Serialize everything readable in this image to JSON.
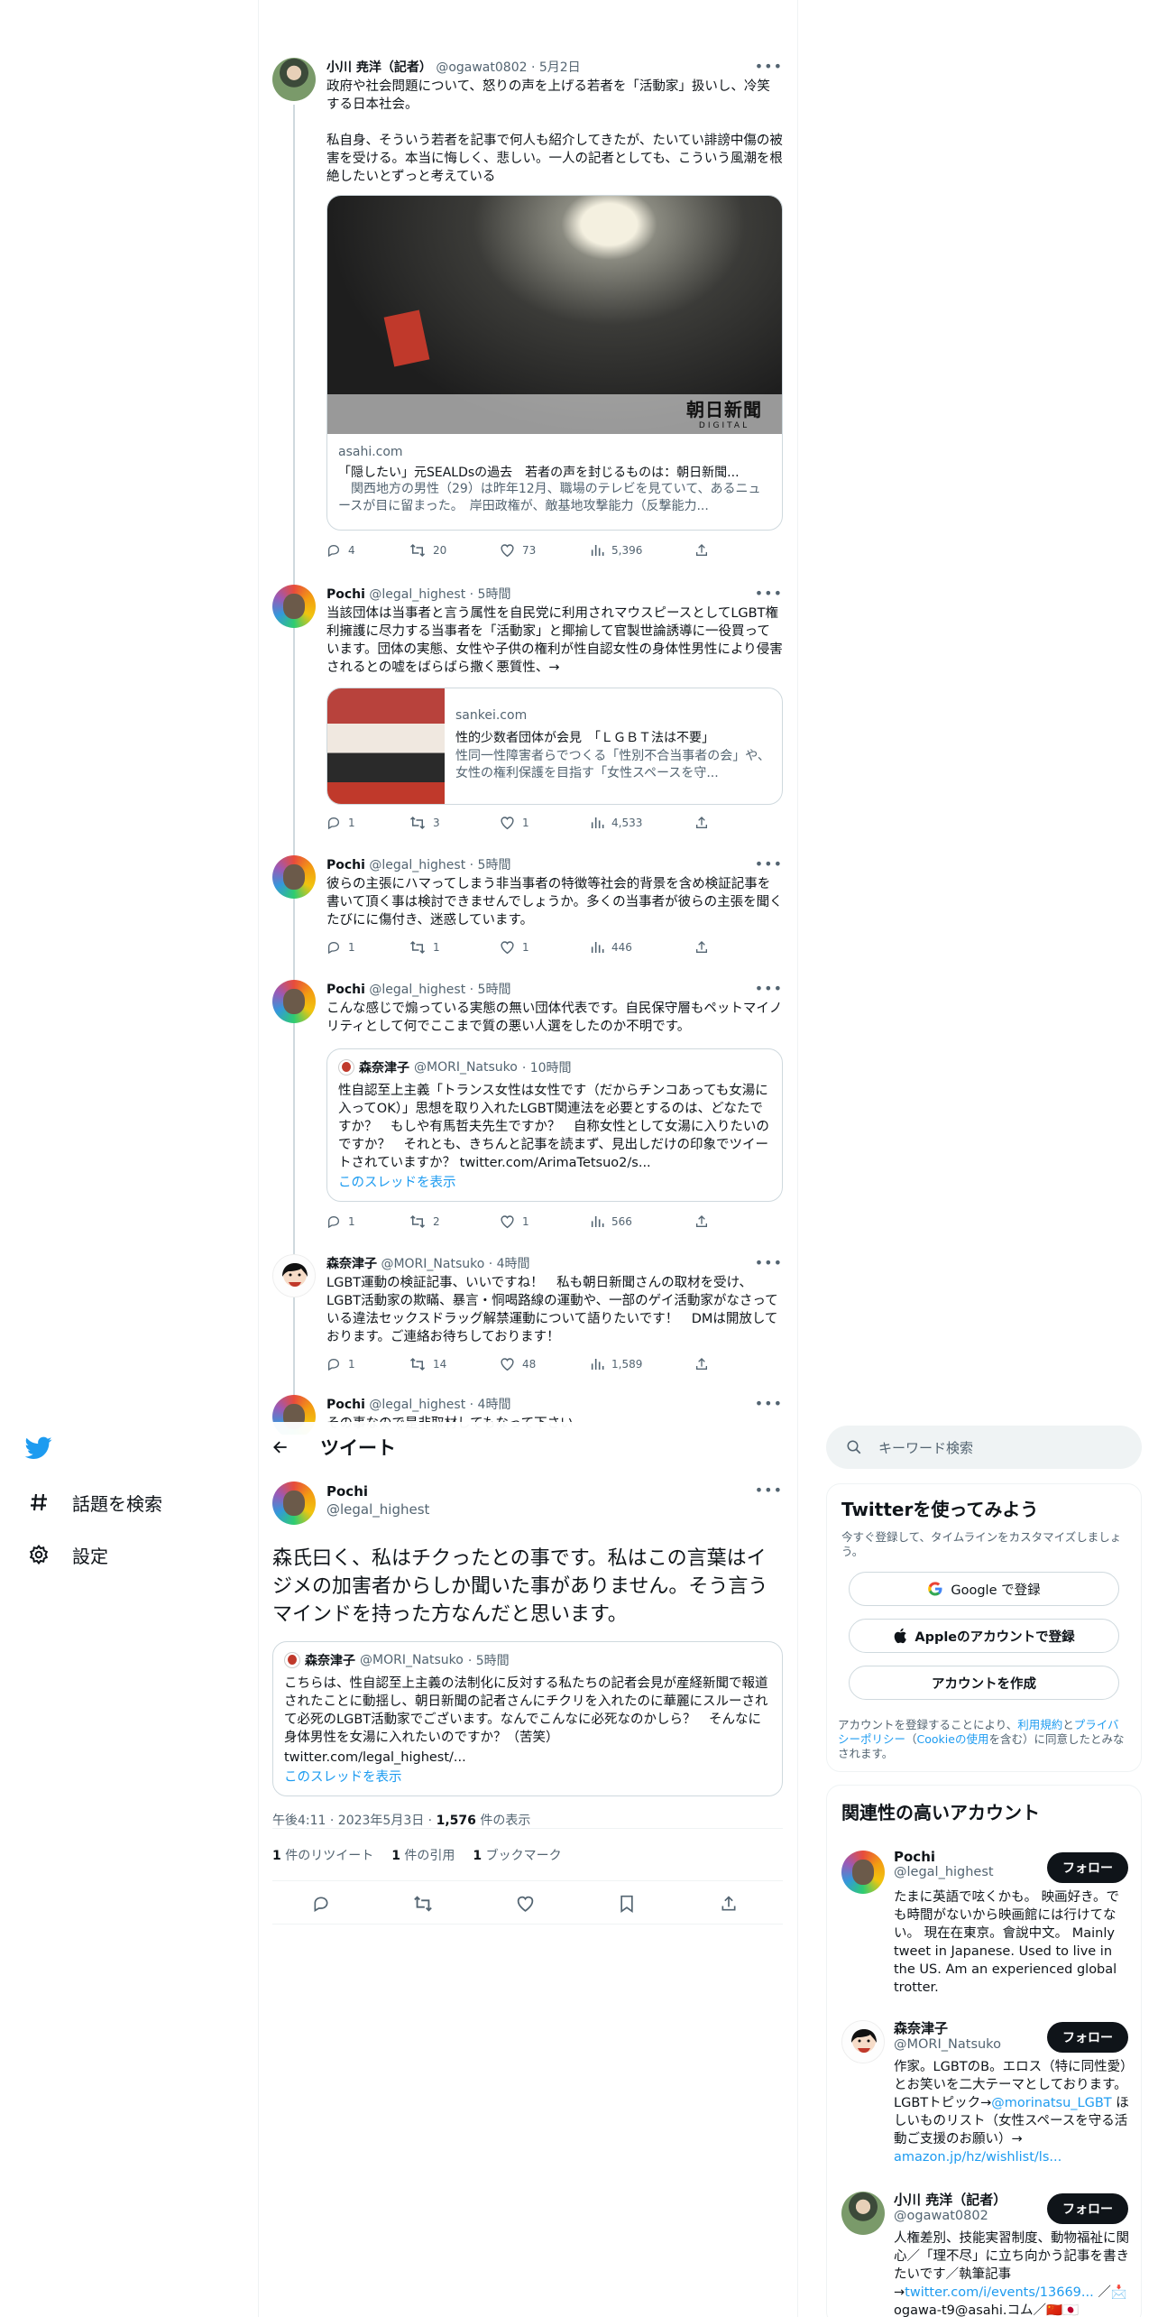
{
  "nav": {
    "explore_label": "話題を検索",
    "settings_label": "設定"
  },
  "thread": [
    {
      "name": "小川 尭洋（記者）",
      "handle": "@ogawat0802",
      "time": "· 5月2日",
      "text1": "政府や社会問題について、怒りの声を上げる若者を「活動家」扱いし、冷笑する日本社会。",
      "text2": "私自身、そういう若者を記事で何人も紹介してきたが、たいてい誹謗中傷の被害を受ける。本当に悔しく、悲しい。一人の記者としても、こういう風潮を根絶したいとずっと考えている",
      "card_domain": "asahi.com",
      "card_title": "「隠したい」元SEALDsの過去　若者の声を封じるものは：朝日新聞...",
      "card_desc": "　関西地方の男性（29）は昨年12月、職場のテレビを見ていて、あるニュースが目に留まった。　岸田政権が、敵基地攻撃能力（反撃能力...",
      "card_watermark": "朝日新聞",
      "card_watermark_sub": "DIGITAL",
      "replies": "4",
      "retweets": "20",
      "likes": "73",
      "views": "5,396"
    },
    {
      "name": "Pochi",
      "handle": "@legal_highest",
      "time": "· 5時間",
      "text1": "当該団体は当事者と言う属性を自民党に利用されマウスピースとしてLGBT権利擁護に尽力する当事者を「活動家」と揶揄して官製世論誘導に一役買っています。団体の実態、女性や子供の権利が性自認女性の身体性男性により侵害されるとの嘘をばらばら撒く悪質性、→",
      "card_domain": "sankei.com",
      "card_title": "性的少数者団体が会見　「ＬＧＢＴ法は不要」",
      "card_desc": "性同一性障害者らでつくる「性別不合当事者の会」や、女性の権利保護を目指す「女性スペースを守...",
      "replies": "1",
      "retweets": "3",
      "likes": "1",
      "views": "4,533"
    },
    {
      "name": "Pochi",
      "handle": "@legal_highest",
      "time": "· 5時間",
      "text1": "彼らの主張にハマってしまう非当事者の特徴等社会的背景を含め検証記事を書いて頂く事は検討できませんでしょうか。多くの当事者が彼らの主張を聞くたびにに傷付き、迷惑しています。",
      "replies": "1",
      "retweets": "1",
      "likes": "1",
      "views": "446"
    },
    {
      "name": "Pochi",
      "handle": "@legal_highest",
      "time": "· 5時間",
      "text1": "こんな感じで煽っている実態の無い団体代表です。自民保守層もペットマイノリティとして何でここまで質の悪い人選をしたのか不明です。",
      "quote_name": "森奈津子",
      "quote_handle": "@MORI_Natsuko",
      "quote_time": "· 10時間",
      "quote_text": "性自認至上主義「トランス女性は女性です（だからチンコあっても女湯に入ってOK）」思想を取り入れたLGBT関連法を必要とするのは、どなたですか？　もしや有馬哲夫先生ですか？　自称女性として女湯に入りたいのですか？　それとも、きちんと記事を読まず、見出しだけの印象でツイートされていますか？ twitter.com/ArimaTetsuo2/s...",
      "quote_thread_link": "このスレッドを表示",
      "replies": "1",
      "retweets": "2",
      "likes": "1",
      "views": "566"
    },
    {
      "name": "森奈津子",
      "handle": "@MORI_Natsuko",
      "time": "· 4時間",
      "text1": "LGBT運動の検証記事、いいですね！　私も朝日新聞さんの取材を受け、LGBT活動家の欺瞞、暴言・恫喝路線の運動や、一部のゲイ活動家がなさっている違法セックスドラッグ解禁運動について語りたいです！　DMは開放しております。ご連絡お待ちしております！",
      "replies": "1",
      "retweets": "14",
      "likes": "48",
      "views": "1,589"
    },
    {
      "name": "Pochi",
      "handle": "@legal_highest",
      "time": "· 4時間",
      "text1": "その事なので是非取材してもなって下さい"
    }
  ],
  "header": {
    "title": "ツイート"
  },
  "main": {
    "name": "Pochi",
    "handle": "@legal_highest",
    "text": "森氏曰く、私はチクったとの事です。私はこの言葉はイジメの加害者からしか聞いた事がありません。そう言うマインドを持った方なんだと思います。",
    "quote_name": "森奈津子",
    "quote_handle": "@MORI_Natsuko",
    "quote_time": "· 5時間",
    "quote_text": "こちらは、性自認至上主義の法制化に反対する私たちの記者会見が産経新聞で報道されたことに動揺し、朝日新聞の記者さんにチクリを入れたのに華麗にスルーされて必死のLGBT活動家でございます。なんでこんなに必死なのかしら？　そんなに身体男性を女湯に入れたいのですか？（苦笑）",
    "quote_link": "twitter.com/legal_highest/...",
    "quote_thread_link": "このスレッドを表示",
    "timestamp": "午後4:11 · 2023年5月3日 · ",
    "views_count": "1,576",
    "views_label": " 件の表示",
    "retweets_count": "1",
    "retweets_label": " 件のリツイート",
    "quotes_count": "1",
    "quotes_label": " 件の引用",
    "bookmarks_count": "1",
    "bookmarks_label": " ブックマーク"
  },
  "search": {
    "placeholder": "キーワード検索"
  },
  "signup": {
    "title": "Twitterを使ってみよう",
    "subtitle": "今すぐ登録して、タイムラインをカスタマイズしましょう。",
    "google_label": "Google で登録",
    "apple_label": "Appleのアカウントで登録",
    "create_label": "アカウントを作成",
    "legal_prefix": "アカウントを登録することにより、",
    "terms_link": "利用規約",
    "and": "と",
    "privacy_link": "プライバシーポリシー",
    "cookie_prefix": "（",
    "cookie_link": "Cookieの使用",
    "legal_suffix": "を含む）に同意したとみなされます。"
  },
  "related": {
    "title": "関連性の高いアカウント",
    "follow_label": "フォロー",
    "accounts": [
      {
        "name": "Pochi",
        "handle": "@legal_highest",
        "bio": "たまに英語で呟くかも。 映画好き。でも時間がないから映画館には行けてない。 現在在東京。會說中文。 Mainly tweet in Japanese. Used to live in the US. Am an experienced global trotter."
      },
      {
        "name": "森奈津子",
        "handle": "@MORI_Natsuko",
        "bio_a": "作家。LGBTのB。エロス（特に同性愛）とお笑いを二大テーマとしております。LGBTトピック→",
        "bio_link1": "@morinatsu_LGBT",
        "bio_b": " ほしいものリスト（女性スペースを守る活動ご支援のお願い）→ ",
        "bio_link2": "amazon.jp/hz/wishlist/ls..."
      },
      {
        "name": "小川 尭洋（記者）",
        "handle": "@ogawat0802",
        "bio_a": "人権差別、技能実習制度、動物福祉に関心／「理不尽」に立ち向かう記事を書きたいです／執筆記事→",
        "bio_link1": "twitter.com/i/events/13669...",
        "bio_b": " ／📩ogawa-t9@asahi.コム／🇨🇳🇯🇵"
      }
    ]
  },
  "colors": {
    "accent": "#1d9bf0",
    "text": "#0f1419",
    "muted": "#536471",
    "border": "#cfd9de"
  }
}
